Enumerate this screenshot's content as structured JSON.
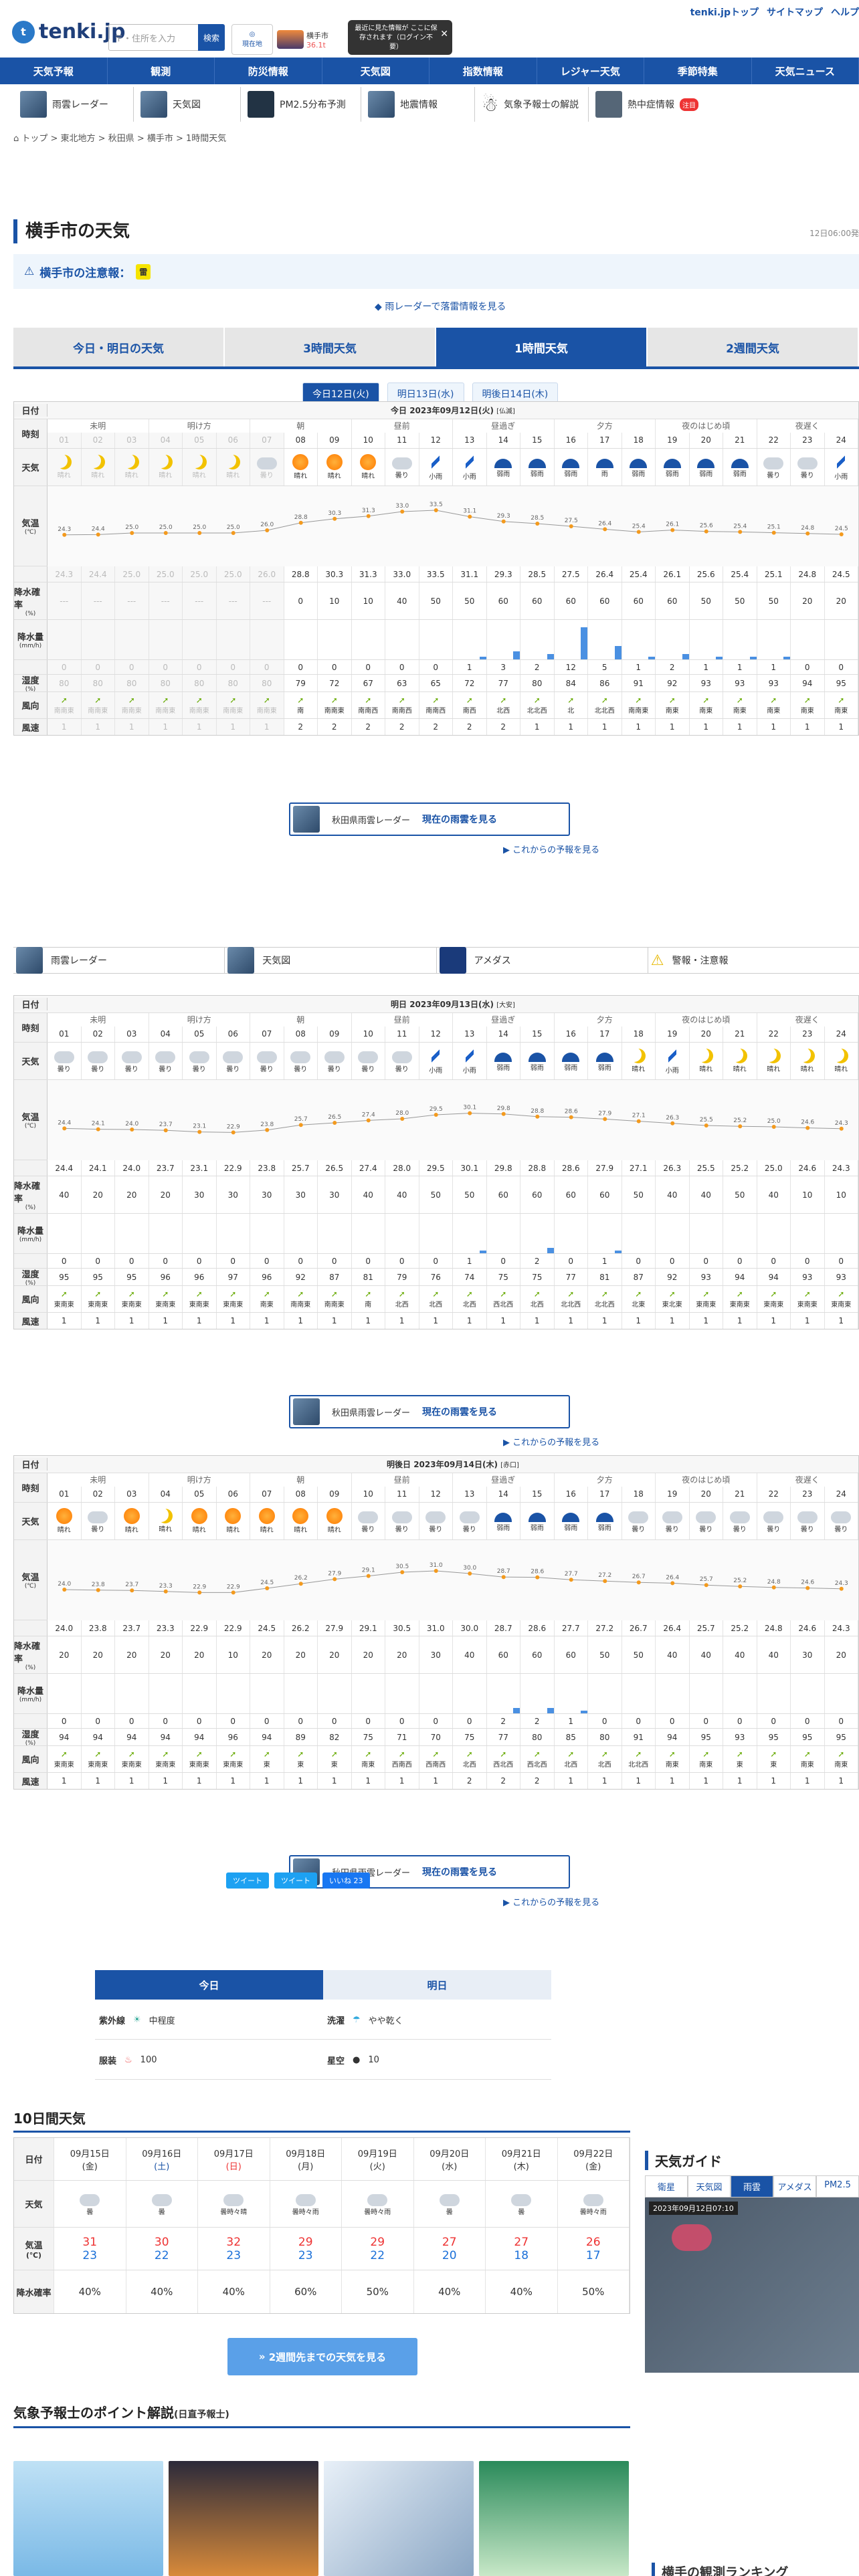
{
  "header": {
    "logo": "tenki.jp",
    "search_placeholder": "〒・住所を入力",
    "search_btn": "検索",
    "loc_label": "現在地",
    "cur_city": "横手市",
    "cur_temp": "36.1t",
    "tip": "最近に見た情報が ここに保存されます（ログイン不要）",
    "toplinks": [
      "tenki.jpトップ",
      "サイトマップ",
      "ヘルプ"
    ]
  },
  "nav": [
    "天気予報",
    "観測",
    "防災情報",
    "天気図",
    "指数情報",
    "レジャー天気",
    "季節特集",
    "天気ニュース"
  ],
  "subnav": [
    "雨雲レーダー",
    "天気図",
    "PM2.5分布予測",
    "地震情報",
    "気象予報士の解説",
    "熱中症情報"
  ],
  "subnav_badge": "注目",
  "breadcrumb": "トップ > 東北地方 > 秋田県 > 横手市 > 1時間天気",
  "page": {
    "title": "横手市の天気",
    "time": "12日06:00発",
    "alert_label": "横手市の注意報：",
    "alert_badge": "雷",
    "radar_link": "雨レーダーで落雷情報を見る"
  },
  "tabs": [
    "今日・明日の天気",
    "3時間天気",
    "1時間天気",
    "2週間天気"
  ],
  "daytabs": [
    "今日12日(火)",
    "明日13日(水)",
    "明後日14日(木)"
  ],
  "labels": {
    "date": "日付",
    "hour": "時刻",
    "weather": "天気",
    "temp": "気温",
    "temp_unit": "(℃)",
    "prob": "降水確率",
    "prob_unit": "(%)",
    "precip": "降水量",
    "precip_unit": "(mm/h)",
    "hum": "湿度",
    "hum_unit": "(%)",
    "wind": "風向",
    "speed": "風速",
    "speed_unit": "(m/s)"
  },
  "bands": [
    "未明",
    "明け方",
    "朝",
    "昼前",
    "昼過ぎ",
    "夕方",
    "夜のはじめ頃",
    "夜遅く"
  ],
  "hours": [
    "01",
    "02",
    "03",
    "04",
    "05",
    "06",
    "07",
    "08",
    "09",
    "10",
    "11",
    "12",
    "13",
    "14",
    "15",
    "16",
    "17",
    "18",
    "19",
    "20",
    "21",
    "22",
    "23",
    "24"
  ],
  "days": [
    {
      "title": "今日 2023年09月12日(火)",
      "rokuyo": "[仏滅]",
      "past": 7,
      "weather": [
        "晴れ",
        "晴れ",
        "晴れ",
        "晴れ",
        "晴れ",
        "晴れ",
        "曇り",
        "晴れ",
        "晴れ",
        "晴れ",
        "曇り",
        "小雨",
        "小雨",
        "弱雨",
        "弱雨",
        "弱雨",
        "雨",
        "弱雨",
        "弱雨",
        "弱雨",
        "弱雨",
        "曇り",
        "曇り",
        "小雨"
      ],
      "icons": [
        "moon",
        "moon",
        "moon",
        "moon",
        "moon",
        "moon",
        "cloud",
        "sun",
        "sun",
        "sun",
        "cloud",
        "rain",
        "rain",
        "umb",
        "umb",
        "umb",
        "umb",
        "umb",
        "umb",
        "umb",
        "umb",
        "cloud",
        "cloud",
        "rain"
      ],
      "temp": [
        "24.3",
        "24.4",
        "25.0",
        "25.0",
        "25.0",
        "25.0",
        "26.0",
        "28.8",
        "30.3",
        "31.3",
        "33.0",
        "33.5",
        "31.1",
        "29.3",
        "28.5",
        "27.5",
        "26.4",
        "25.4",
        "26.1",
        "25.6",
        "25.4",
        "25.1",
        "24.8",
        "24.5"
      ],
      "prob": [
        "---",
        "---",
        "---",
        "---",
        "---",
        "---",
        "---",
        "0",
        "10",
        "10",
        "40",
        "50",
        "50",
        "60",
        "60",
        "60",
        "60",
        "60",
        "60",
        "50",
        "50",
        "50",
        "20",
        "20"
      ],
      "precip": [
        "0",
        "0",
        "0",
        "0",
        "0",
        "0",
        "0",
        "0",
        "0",
        "0",
        "0",
        "0",
        "1",
        "3",
        "2",
        "12",
        "5",
        "1",
        "2",
        "1",
        "1",
        "1",
        "0",
        "0"
      ],
      "hum": [
        "80",
        "80",
        "80",
        "80",
        "80",
        "80",
        "80",
        "79",
        "72",
        "67",
        "63",
        "65",
        "72",
        "77",
        "80",
        "84",
        "86",
        "91",
        "92",
        "93",
        "93",
        "93",
        "94",
        "95"
      ],
      "wind": [
        "南南東",
        "南南東",
        "南南東",
        "南南東",
        "南南東",
        "南南東",
        "南南東",
        "南",
        "南南東",
        "南南西",
        "南南西",
        "南南西",
        "南西",
        "北西",
        "北北西",
        "北",
        "北北西",
        "南南東",
        "南東",
        "南東",
        "南東",
        "南東",
        "南東",
        "南東"
      ],
      "speed": [
        "1",
        "1",
        "1",
        "1",
        "1",
        "1",
        "1",
        "2",
        "2",
        "2",
        "2",
        "2",
        "2",
        "2",
        "1",
        "1",
        "1",
        "1",
        "1",
        "1",
        "1",
        "1",
        "1",
        "1"
      ]
    },
    {
      "title": "明日 2023年09月13日(水)",
      "rokuyo": "[大安]",
      "past": 0,
      "weather": [
        "曇り",
        "曇り",
        "曇り",
        "曇り",
        "曇り",
        "曇り",
        "曇り",
        "曇り",
        "曇り",
        "曇り",
        "曇り",
        "小雨",
        "小雨",
        "弱雨",
        "弱雨",
        "弱雨",
        "弱雨",
        "晴れ",
        "小雨",
        "晴れ",
        "晴れ",
        "晴れ",
        "晴れ",
        "晴れ"
      ],
      "icons": [
        "cloud",
        "cloud",
        "cloud",
        "cloud",
        "cloud",
        "cloud",
        "cloud",
        "cloud",
        "cloud",
        "cloud",
        "cloud",
        "rain",
        "rain",
        "umb",
        "umb",
        "umb",
        "umb",
        "moon",
        "rain",
        "moon",
        "moon",
        "moon",
        "moon",
        "moon"
      ],
      "temp": [
        "24.4",
        "24.1",
        "24.0",
        "23.7",
        "23.1",
        "22.9",
        "23.8",
        "25.7",
        "26.5",
        "27.4",
        "28.0",
        "29.5",
        "30.1",
        "29.8",
        "28.8",
        "28.6",
        "27.9",
        "27.1",
        "26.3",
        "25.5",
        "25.2",
        "25.0",
        "24.6",
        "24.3"
      ],
      "prob": [
        "40",
        "20",
        "20",
        "20",
        "30",
        "30",
        "30",
        "30",
        "30",
        "40",
        "40",
        "50",
        "50",
        "60",
        "60",
        "60",
        "60",
        "50",
        "40",
        "40",
        "50",
        "40",
        "10",
        "10"
      ],
      "precip": [
        "0",
        "0",
        "0",
        "0",
        "0",
        "0",
        "0",
        "0",
        "0",
        "0",
        "0",
        "0",
        "1",
        "0",
        "2",
        "0",
        "1",
        "0",
        "0",
        "0",
        "0",
        "0",
        "0",
        "0"
      ],
      "hum": [
        "95",
        "95",
        "95",
        "96",
        "96",
        "97",
        "96",
        "92",
        "87",
        "81",
        "79",
        "76",
        "74",
        "75",
        "75",
        "77",
        "81",
        "87",
        "92",
        "93",
        "94",
        "94",
        "93",
        "93"
      ],
      "wind": [
        "東南東",
        "東南東",
        "東南東",
        "東南東",
        "東南東",
        "東南東",
        "南東",
        "南南東",
        "南南東",
        "南",
        "北西",
        "北西",
        "北西",
        "西北西",
        "北西",
        "北北西",
        "北北西",
        "北東",
        "東北東",
        "東南東",
        "東南東",
        "東南東",
        "東南東",
        "東南東"
      ],
      "speed": [
        "1",
        "1",
        "1",
        "1",
        "1",
        "1",
        "1",
        "1",
        "1",
        "1",
        "1",
        "1",
        "1",
        "1",
        "1",
        "1",
        "1",
        "1",
        "1",
        "1",
        "1",
        "1",
        "1",
        "1"
      ]
    },
    {
      "title": "明後日 2023年09月14日(木)",
      "rokuyo": "[赤口]",
      "past": 0,
      "weather": [
        "晴れ",
        "曇り",
        "晴れ",
        "晴れ",
        "晴れ",
        "晴れ",
        "晴れ",
        "晴れ",
        "晴れ",
        "曇り",
        "曇り",
        "曇り",
        "曇り",
        "弱雨",
        "弱雨",
        "弱雨",
        "弱雨",
        "曇り",
        "曇り",
        "曇り",
        "曇り",
        "曇り",
        "曇り",
        "曇り"
      ],
      "icons": [
        "sun",
        "cloud",
        "sun",
        "moon",
        "sun",
        "sun",
        "sun",
        "sun",
        "sun",
        "cloud",
        "cloud",
        "cloud",
        "cloud",
        "umb",
        "umb",
        "umb",
        "umb",
        "cloud",
        "cloud",
        "cloud",
        "cloud",
        "cloud",
        "cloud",
        "cloud"
      ],
      "temp": [
        "24.0",
        "23.8",
        "23.7",
        "23.3",
        "22.9",
        "22.9",
        "24.5",
        "26.2",
        "27.9",
        "29.1",
        "30.5",
        "31.0",
        "30.0",
        "28.7",
        "28.6",
        "27.7",
        "27.2",
        "26.7",
        "26.4",
        "25.7",
        "25.2",
        "24.8",
        "24.6",
        "24.3"
      ],
      "prob": [
        "20",
        "20",
        "20",
        "20",
        "20",
        "10",
        "20",
        "20",
        "20",
        "20",
        "20",
        "30",
        "40",
        "60",
        "60",
        "60",
        "50",
        "50",
        "40",
        "40",
        "40",
        "40",
        "30",
        "20"
      ],
      "precip": [
        "0",
        "0",
        "0",
        "0",
        "0",
        "0",
        "0",
        "0",
        "0",
        "0",
        "0",
        "0",
        "0",
        "2",
        "2",
        "1",
        "0",
        "0",
        "0",
        "0",
        "0",
        "0",
        "0",
        "0"
      ],
      "hum": [
        "94",
        "94",
        "94",
        "94",
        "94",
        "96",
        "94",
        "89",
        "82",
        "75",
        "71",
        "70",
        "75",
        "77",
        "80",
        "85",
        "80",
        "91",
        "94",
        "95",
        "93",
        "95",
        "95",
        "95"
      ],
      "wind": [
        "東南東",
        "東南東",
        "東南東",
        "東南東",
        "東南東",
        "東南東",
        "東",
        "東",
        "東",
        "南東",
        "西南西",
        "西南西",
        "北西",
        "西北西",
        "西北西",
        "北西",
        "北西",
        "北北西",
        "南東",
        "南東",
        "東",
        "東",
        "南東",
        "南東"
      ],
      "speed": [
        "1",
        "1",
        "1",
        "1",
        "1",
        "1",
        "1",
        "1",
        "1",
        "1",
        "1",
        "1",
        "2",
        "2",
        "2",
        "1",
        "1",
        "1",
        "1",
        "1",
        "1",
        "1",
        "1",
        "1"
      ]
    }
  ],
  "radar_btn": {
    "label": "秋田県雨雲レーダー",
    "cta": "現在の雨雲を見る",
    "later": "これからの予報を見る"
  },
  "links2": [
    "雨雲レーダー",
    "天気図",
    "アメダス",
    "警報・注意報"
  ],
  "social": [
    "ツイート",
    "ツイート",
    "いいね 23"
  ],
  "index": {
    "tabs": [
      "今日",
      "明日"
    ],
    "items": [
      {
        "name": "紫外線",
        "value": "中程度"
      },
      {
        "name": "洗濯",
        "value": "やや乾く"
      },
      {
        "name": "服装",
        "value": "100"
      },
      {
        "name": "星空",
        "value": "10"
      }
    ]
  },
  "tenday": {
    "title": "10日間天気",
    "date_label": "日付",
    "weather_label": "天気",
    "temp_label": "気温",
    "temp_unit": "(℃)",
    "prob_label": "降水確率",
    "dates": [
      "09月15日",
      "09月16日",
      "09月17日",
      "09月18日",
      "09月19日",
      "09月20日",
      "09月21日",
      "09月22日"
    ],
    "dows": [
      "(金)",
      "(土)",
      "(日)",
      "(月)",
      "(火)",
      "(水)",
      "(木)",
      "(金)"
    ],
    "weather": [
      "曇",
      "曇",
      "曇時々晴",
      "曇時々雨",
      "曇時々雨",
      "曇",
      "曇",
      "曇時々雨"
    ],
    "high": [
      "31",
      "30",
      "32",
      "29",
      "29",
      "27",
      "27",
      "26"
    ],
    "low": [
      "23",
      "22",
      "23",
      "23",
      "22",
      "20",
      "18",
      "17"
    ],
    "prob": [
      "40%",
      "40%",
      "40%",
      "60%",
      "50%",
      "40%",
      "40%",
      "50%"
    ],
    "btn": "2週間先までの天気を見る"
  },
  "guide": {
    "title": "天気ガイド",
    "tabs": [
      "衛星",
      "天気図",
      "雨雲",
      "アメダス",
      "PM2.5"
    ],
    "stamp": "2023年09月12日07:10"
  },
  "points": {
    "title": "気象予報士のポイント解説",
    "sub": "(日直予報士)"
  },
  "ranking": {
    "title": "横手の観測ランキング"
  }
}
